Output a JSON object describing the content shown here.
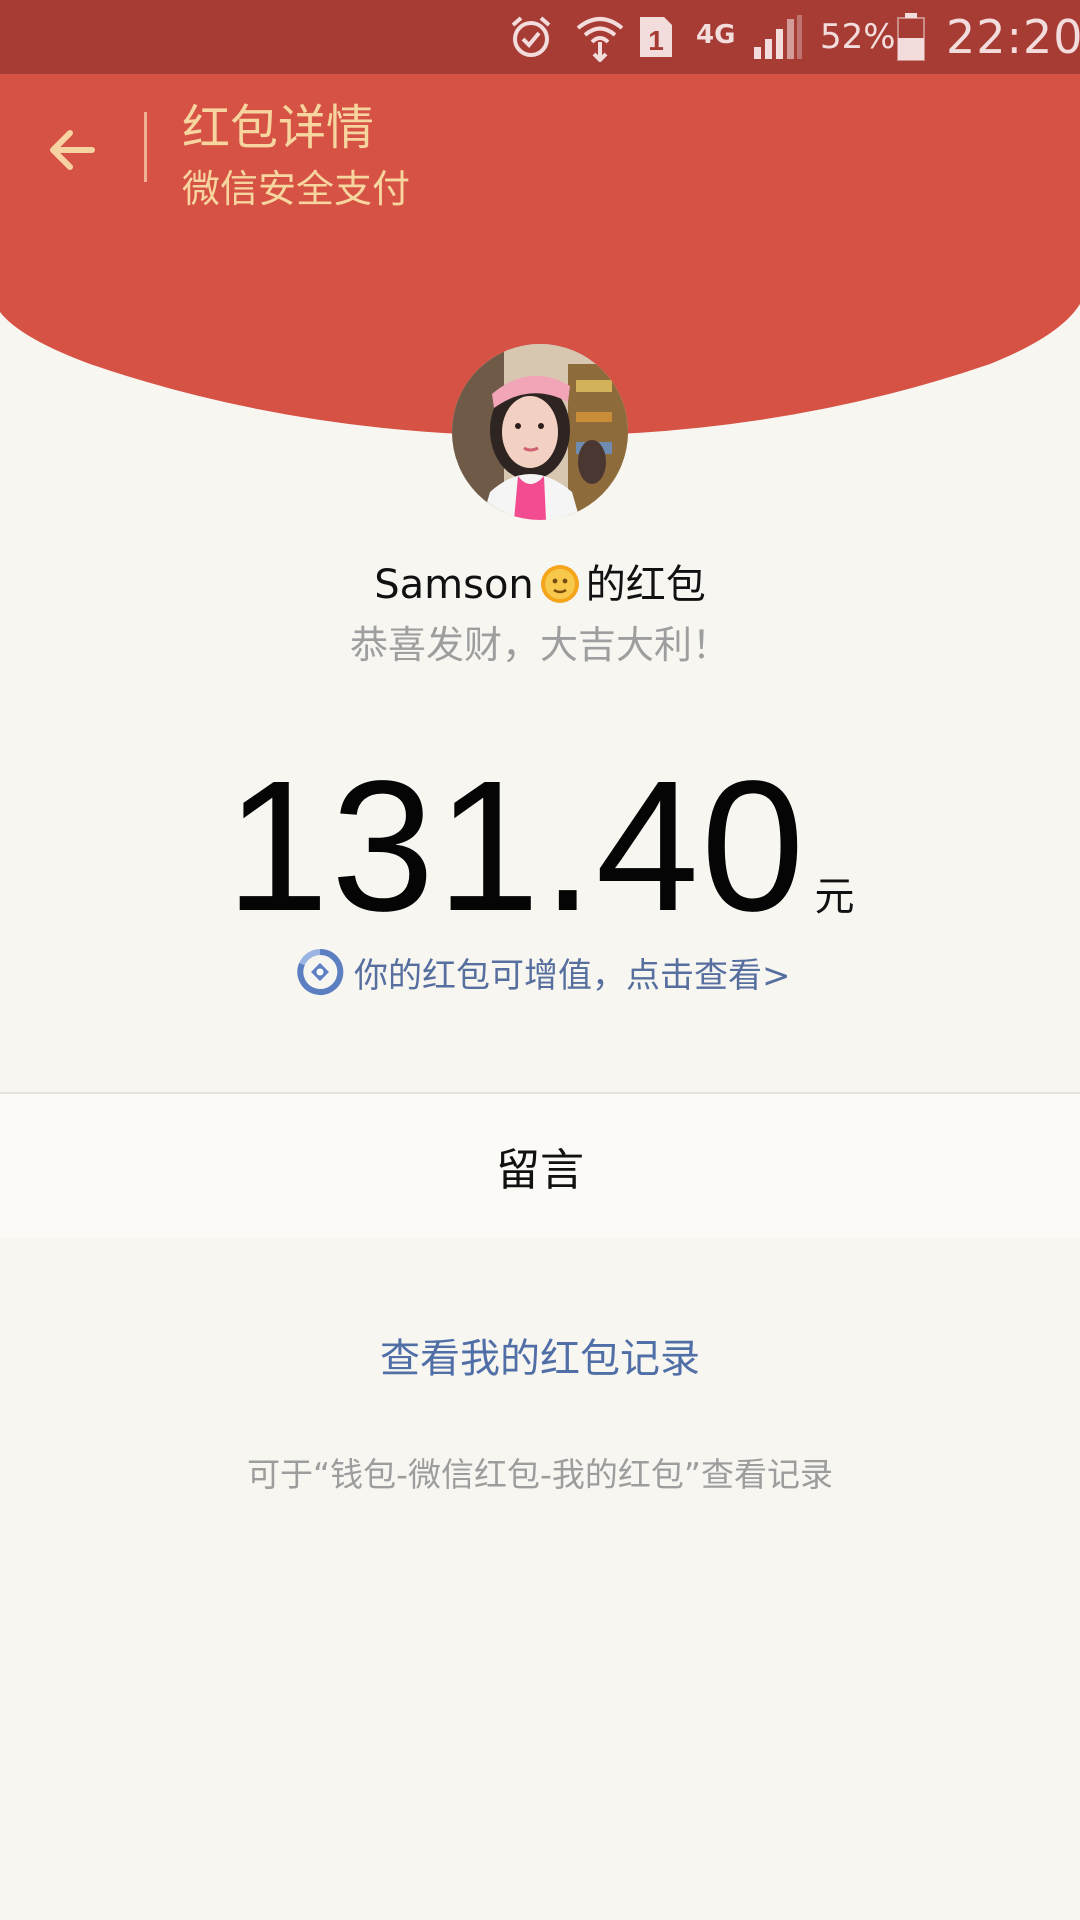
{
  "status_bar": {
    "network": "4G",
    "sim_slot": "1",
    "battery": "52%",
    "time": "22:20",
    "icons": [
      "alarm-icon",
      "wifi-icon",
      "sim-icon",
      "signal-icon",
      "battery-icon"
    ]
  },
  "header": {
    "title": "红包详情",
    "subtitle": "微信安全支付",
    "back_icon": "back-arrow-icon"
  },
  "envelope": {
    "sender_name": "Samson",
    "sender_emoji": "sun-face-emoji",
    "sender_suffix": "的红包",
    "blessing": "恭喜发财，大吉大利！",
    "amount": "131.40",
    "unit": "元",
    "growth_link": "你的红包可增值，点击查看>"
  },
  "message": {
    "label": "留言"
  },
  "footer": {
    "record_link": "查看我的红包记录",
    "record_hint": "可于“钱包-微信红包-我的红包”查看记录"
  },
  "colors": {
    "header_red": "#d65244",
    "status_bar": "#a73c35",
    "header_text": "#f7d59f",
    "link_blue": "#4f6fa6",
    "background": "#f8f6f1"
  }
}
